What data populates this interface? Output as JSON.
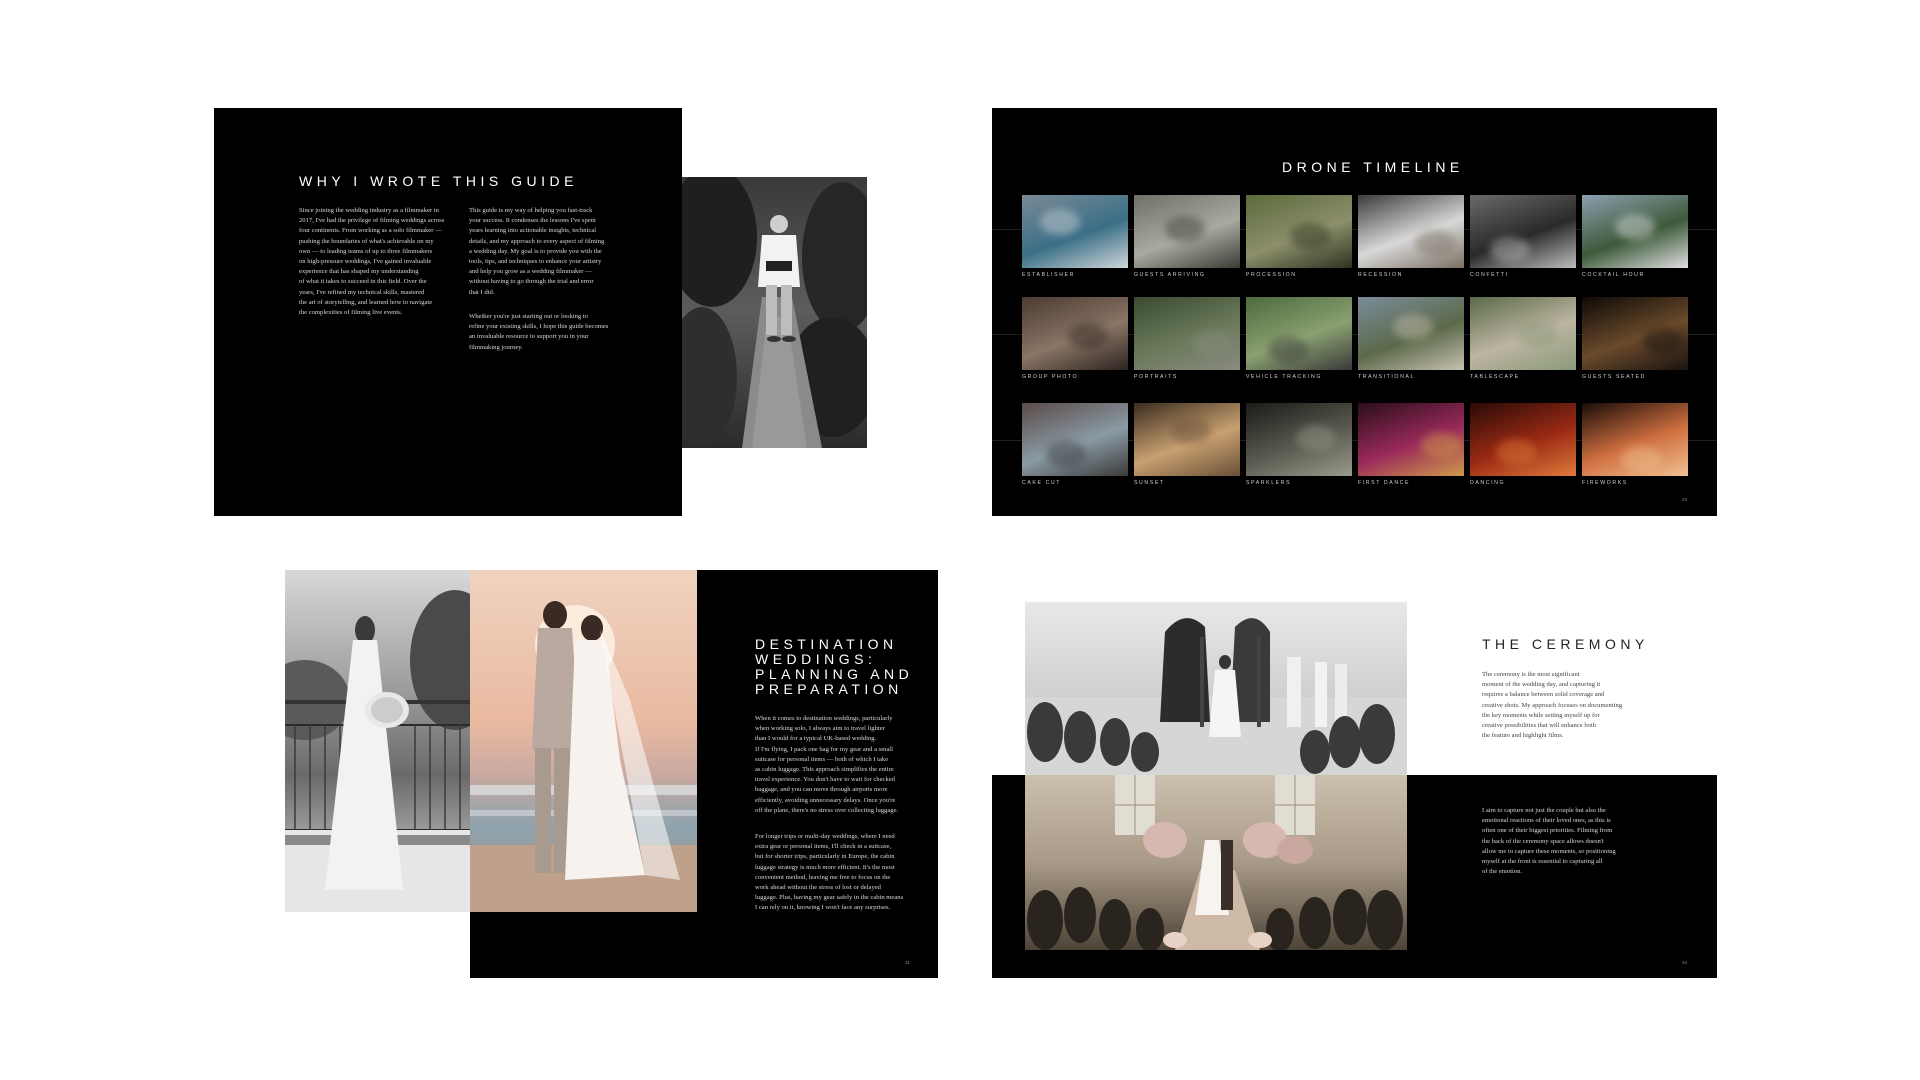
{
  "spreads": {
    "why": {
      "title": "WHY I WROTE THIS GUIDE",
      "col1": "Since joining the wedding industry as a filmmaker in\n2017, I've had the privilege of filming weddings across\nfour continents. From working as a solo filmmaker —\npushing the boundaries of what's achievable on my\nown — to leading teams of up to three filmmakers\non high-pressure weddings, I've gained invaluable\nexperience that has shaped my understanding\nof what it takes to succeed in this field. Over the\nyears, I've refined my technical skills, mastered\nthe art of storytelling, and learned how to navigate\nthe complexities of filming live events.",
      "col2a": "This guide is my way of helping you fast-track\nyour success. It condenses the lessons I've spent\nyears learning into actionable insights, technical\ndetails, and my approach to every aspect of filming\na wedding day. My goal is to provide you with the\ntools, tips, and techniques to enhance your artistry\nand help you grow as a wedding filmmaker —\nwithout having to go through the trial and error\nthat I did.",
      "col2b": "Whether you're just starting out or looking to\nrefine your existing skills, I hope this guide becomes\nan invaluable resource to support you in your\nfilmmaking journey."
    },
    "drone": {
      "title": "DRONE TIMELINE",
      "labels": [
        "ESTABLISHER",
        "GUESTS ARRIVING",
        "PROCESSION",
        "RECESSION",
        "CONFETTI",
        "COCKTAIL HOUR",
        "GROUP PHOTO",
        "PORTRAITS",
        "VEHICLE TRACKING",
        "TRANSITIONAL",
        "TABLESCAPE",
        "GUESTS SEATED",
        "CAKE CUT",
        "SUNSET",
        "SPARKLERS",
        "FIRST DANCE",
        "DANCING",
        "FIREWORKS"
      ],
      "page_number": "23"
    },
    "destination": {
      "title": "DESTINATION\nWEDDINGS:\nPLANNING AND\nPREPARATION",
      "para1": "When it comes to destination weddings, particularly\nwhen working solo, I always aim to travel lighter\nthan I would for a typical UK-based wedding.\nIf I'm flying, I pack one bag for my gear and a small\nsuitcase for personal items — both of which I take\nas cabin luggage. This approach simplifies the entire\ntravel experience. You don't have to wait for checked\nbaggage, and you can move through airports more\nefficiently, avoiding unnecessary delays. Once you're\noff the plane, there's no stress over collecting luggage.",
      "para2": "For longer trips or multi-day weddings, where I need\nextra gear or personal items, I'll check in a suitcase,\nbut for shorter trips, particularly in Europe, the cabin\nluggage strategy is much more efficient. It's the most\nconvenient method, leaving me free to focus on the\nwork ahead without the stress of lost or delayed\nluggage. Plus, having my gear safely in the cabin means\nI can rely on it, knowing I won't face any surprises.",
      "page_number": "31"
    },
    "ceremony": {
      "title": "THE CEREMONY",
      "para1": "The ceremony is the most significant\nmoment of the wedding day, and capturing it\nrequires a balance between solid coverage and\ncreative shots. My approach focuses on documenting\nthe key moments while setting myself up for\ncreative possibilities that will enhance both\nthe feature and highlight films.",
      "para2": "I aim to capture not just the couple but also the\nemotional reactions of their loved ones, as this is\noften one of their biggest priorities. Filming from\nthe back of the ceremony space allows doesn't\nallow me to capture these moments, so positioning\nmyself at the front is essential to capturing all\nof the emotion.",
      "page_number": "44"
    }
  }
}
